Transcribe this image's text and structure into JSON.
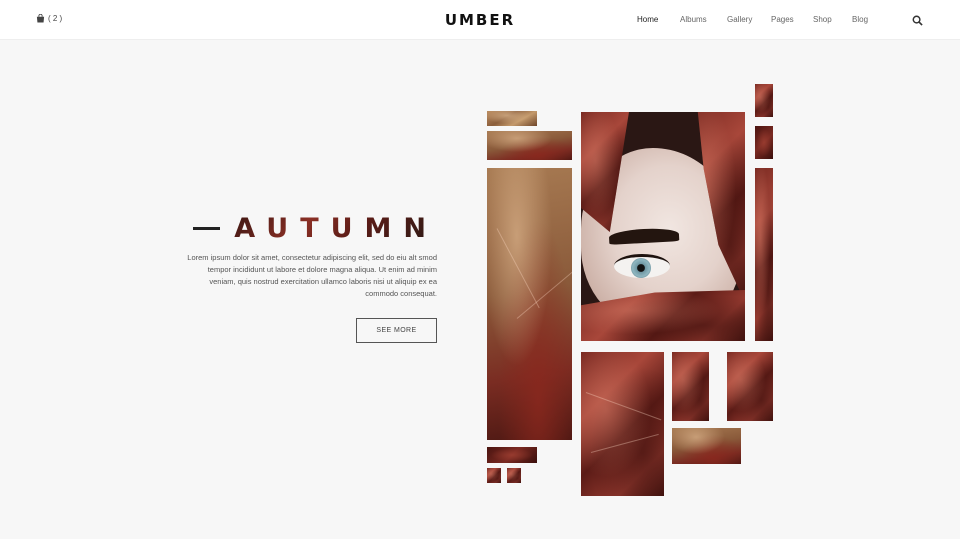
{
  "header": {
    "cart_count": "( 2 )",
    "logo": "UMBER",
    "nav": [
      "Home",
      "Albums",
      "Gallery",
      "Pages",
      "Shop",
      "Blog"
    ],
    "active_nav": "Home",
    "cart_icon": "shopping-bag-icon",
    "search_icon": "search-icon"
  },
  "hero": {
    "title": "AUTUMN",
    "description": "Lorem ipsum dolor sit amet, consectetur adipiscing elit, sed do eiu alt smod tempor incididunt ut labore et dolore magna aliqua. Ut enim ad minim veniam, quis nostrud exercitation ullamco laboris nisi ut aliquip ex ea commodo consequat.",
    "button": "SEE MORE"
  },
  "colors": {
    "accent": "#8a2f25",
    "text_dark": "#222222",
    "background": "#f7f7f7"
  }
}
